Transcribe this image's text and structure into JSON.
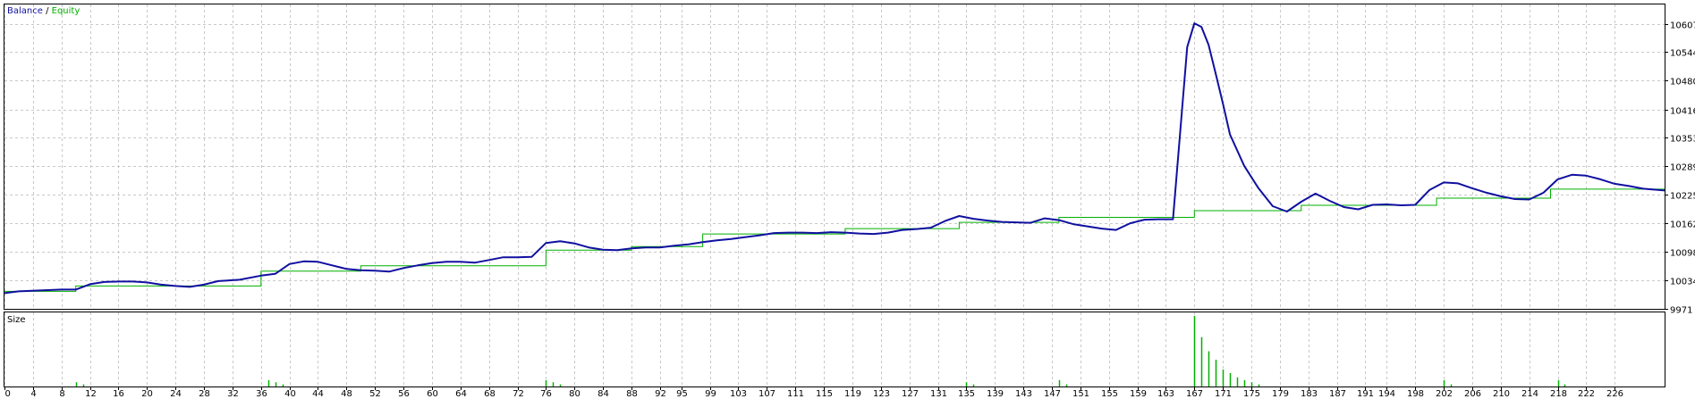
{
  "chart_data": [
    {
      "type": "line",
      "legend": {
        "balance_label": "Balance",
        "separator": " / ",
        "equity_label": "Equity",
        "position": "top-left"
      },
      "colors": {
        "balance": "#1010a0",
        "equity": "#00b000",
        "grid": "#c8c8c8"
      },
      "grid": true,
      "ylim": [
        9971,
        10650
      ],
      "y_ticks": [
        10607,
        10544,
        10480,
        10416,
        10353,
        10289,
        10225,
        10162,
        10098,
        10034,
        9971
      ],
      "xlim": [
        0,
        233
      ],
      "series": [
        {
          "name": "Balance",
          "x": [
            0,
            2,
            5,
            8,
            10,
            12,
            14,
            16,
            18,
            20,
            22,
            24,
            26,
            28,
            30,
            33,
            36,
            38,
            40,
            42,
            44,
            46,
            48,
            50,
            52,
            54,
            56,
            58,
            60,
            62,
            64,
            66,
            68,
            70,
            72,
            74,
            76,
            78,
            80,
            82,
            84,
            86,
            88,
            90,
            92,
            94,
            96,
            98,
            100,
            102,
            104,
            106,
            108,
            110,
            112,
            114,
            116,
            118,
            120,
            122,
            124,
            126,
            128,
            130,
            132,
            134,
            136,
            138,
            140,
            142,
            144,
            146,
            148,
            150,
            152,
            154,
            156,
            158,
            160,
            162,
            164,
            166,
            167,
            168,
            169,
            170,
            171,
            172,
            174,
            176,
            178,
            180,
            182,
            184,
            186,
            188,
            190,
            192,
            194,
            196,
            198,
            200,
            202,
            204,
            206,
            208,
            210,
            212,
            214,
            216,
            218,
            220,
            222,
            224,
            226,
            228,
            230,
            233
          ],
          "y": [
            10006,
            10010,
            10012,
            10014,
            10014,
            10026,
            10031,
            10032,
            10032,
            10030,
            10025,
            10022,
            10020,
            10025,
            10033,
            10036,
            10045,
            10049,
            10071,
            10077,
            10076,
            10068,
            10060,
            10057,
            10056,
            10054,
            10062,
            10068,
            10073,
            10076,
            10076,
            10074,
            10080,
            10086,
            10086,
            10087,
            10118,
            10122,
            10117,
            10108,
            10103,
            10102,
            10106,
            10108,
            10108,
            10112,
            10115,
            10120,
            10124,
            10127,
            10131,
            10135,
            10140,
            10141,
            10141,
            10140,
            10142,
            10141,
            10139,
            10138,
            10141,
            10147,
            10149,
            10152,
            10167,
            10178,
            10172,
            10168,
            10165,
            10164,
            10163,
            10173,
            10169,
            10160,
            10155,
            10150,
            10147,
            10162,
            10170,
            10171,
            10171,
            10555,
            10608,
            10600,
            10560,
            10495,
            10430,
            10360,
            10290,
            10240,
            10200,
            10188,
            10210,
            10228,
            10212,
            10198,
            10193,
            10203,
            10204,
            10202,
            10203,
            10236,
            10253,
            10251,
            10240,
            10230,
            10222,
            10216,
            10215,
            10230,
            10260,
            10270,
            10268,
            10260,
            10250,
            10245,
            10239,
            10235
          ]
        },
        {
          "name": "Equity",
          "x": [
            0,
            10,
            10,
            36,
            36,
            50,
            50,
            76,
            76,
            88,
            88,
            98,
            98,
            118,
            118,
            134,
            134,
            148,
            148,
            167,
            167,
            182,
            182,
            201,
            201,
            217,
            217,
            233
          ],
          "y": [
            10010,
            10010,
            10022,
            10022,
            10055,
            10055,
            10067,
            10067,
            10102,
            10102,
            10110,
            10110,
            10138,
            10138,
            10150,
            10150,
            10164,
            10164,
            10175,
            10175,
            10190,
            10190,
            10202,
            10202,
            10218,
            10218,
            10238,
            10238
          ]
        }
      ]
    },
    {
      "type": "bar",
      "panel_label": "Size",
      "colors": {
        "bar": "#00b000"
      },
      "x_ticks": [
        0,
        4,
        8,
        12,
        16,
        20,
        24,
        28,
        32,
        36,
        40,
        44,
        48,
        52,
        56,
        60,
        64,
        68,
        72,
        76,
        80,
        84,
        88,
        92,
        95,
        99,
        103,
        107,
        111,
        115,
        119,
        123,
        127,
        131,
        135,
        139,
        143,
        147,
        151,
        155,
        159,
        163,
        167,
        171,
        175,
        179,
        183,
        187,
        191,
        194,
        198,
        202,
        206,
        210,
        214,
        218,
        222,
        226
      ],
      "x": [
        10,
        11,
        37,
        38,
        39,
        76,
        77,
        78,
        135,
        136,
        148,
        149,
        167,
        168,
        169,
        170,
        171,
        172,
        173,
        174,
        175,
        176,
        202,
        203,
        218,
        219
      ],
      "values": [
        0.06,
        0.03,
        0.09,
        0.06,
        0.03,
        0.09,
        0.06,
        0.03,
        0.06,
        0.03,
        0.09,
        0.03,
        1.0,
        0.7,
        0.5,
        0.38,
        0.24,
        0.19,
        0.13,
        0.09,
        0.06,
        0.03,
        0.09,
        0.03,
        0.09,
        0.03
      ],
      "ylim": [
        0,
        1
      ]
    }
  ]
}
